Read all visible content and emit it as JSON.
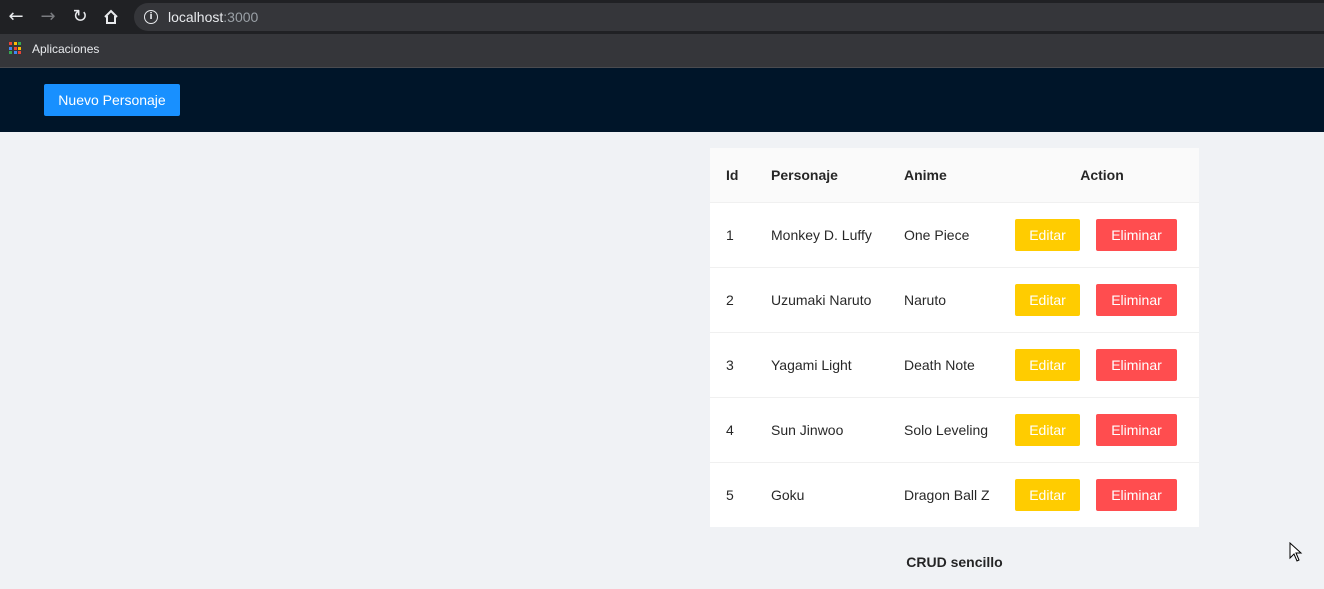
{
  "browser": {
    "url_host": "localhost",
    "url_port": ":3000",
    "bookmarks": [
      {
        "label": "Aplicaciones",
        "icon": "apps-grid-icon"
      }
    ],
    "apps_icon_colors": [
      "#ea4335",
      "#fbbc05",
      "#34a853",
      "#4285f4",
      "#ea4335",
      "#fbbc05",
      "#34a853",
      "#4285f4",
      "#ea4335"
    ]
  },
  "header": {
    "new_button_label": "Nuevo Personaje"
  },
  "table": {
    "columns": [
      "Id",
      "Personaje",
      "Anime",
      "Action"
    ],
    "rows": [
      {
        "id": "1",
        "personaje": "Monkey D. Luffy",
        "anime": "One Piece"
      },
      {
        "id": "2",
        "personaje": "Uzumaki Naruto",
        "anime": "Naruto"
      },
      {
        "id": "3",
        "personaje": "Yagami Light",
        "anime": "Death Note"
      },
      {
        "id": "4",
        "personaje": "Sun Jinwoo",
        "anime": "Solo Leveling"
      },
      {
        "id": "5",
        "personaje": "Goku",
        "anime": "Dragon Ball Z"
      }
    ],
    "edit_label": "Editar",
    "delete_label": "Eliminar"
  },
  "footer": {
    "text": "CRUD sencillo"
  },
  "colors": {
    "header_bg": "#001529",
    "primary": "#1890ff",
    "edit": "#ffcc00",
    "delete": "#ff4d4f",
    "page_bg": "#f0f2f5"
  }
}
